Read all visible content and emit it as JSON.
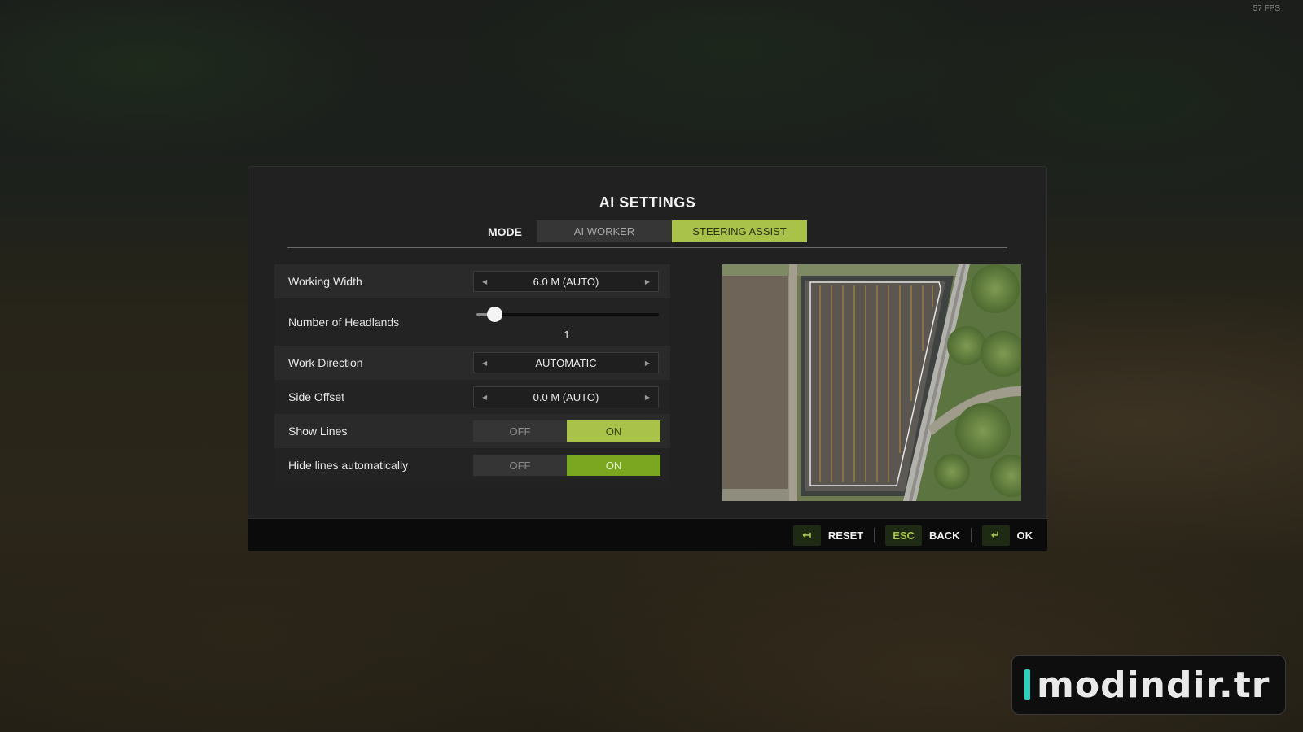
{
  "fps": "57 FPS",
  "dialog": {
    "title": "AI SETTINGS",
    "mode_label": "MODE",
    "mode_tabs": [
      {
        "label": "AI WORKER",
        "active": false
      },
      {
        "label": "STEERING ASSIST",
        "active": true
      }
    ]
  },
  "settings": {
    "working_width": {
      "label": "Working Width",
      "value": "6.0 M (AUTO)"
    },
    "headlands": {
      "label": "Number of Headlands",
      "value": "1",
      "min": 0,
      "max": 10,
      "fraction": 0.1
    },
    "work_direction": {
      "label": "Work Direction",
      "value": "AUTOMATIC"
    },
    "side_offset": {
      "label": "Side Offset",
      "value": "0.0 M (AUTO)"
    },
    "show_lines": {
      "label": "Show Lines",
      "off": "OFF",
      "on": "ON",
      "selected": "ON"
    },
    "hide_lines": {
      "label": "Hide lines automatically",
      "off": "OFF",
      "on": "ON",
      "selected": "ON"
    }
  },
  "preview": {
    "description_icon": "field-map-preview"
  },
  "footer": {
    "reset": {
      "key_icon": "reset-arrows-icon",
      "label": "RESET"
    },
    "back": {
      "key": "ESC",
      "label": "BACK"
    },
    "ok": {
      "key_icon": "enter-key-icon",
      "label": "OK"
    }
  },
  "watermark": {
    "text": "modindir.tr"
  },
  "colors": {
    "accent": "#a8c24a",
    "accent_strong": "#7aa620",
    "watermark_bar": "#2ecfbd"
  }
}
